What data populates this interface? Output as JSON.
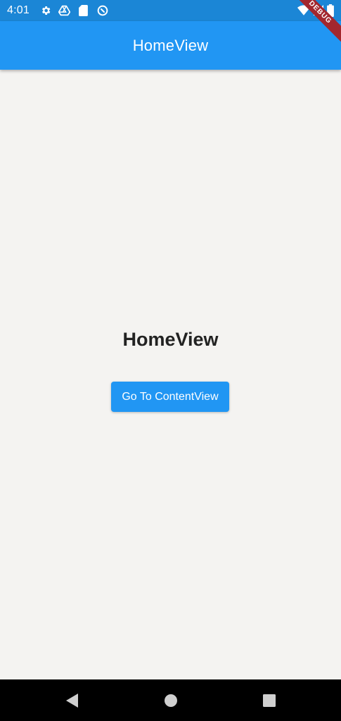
{
  "status_bar": {
    "time": "4:01",
    "icons": [
      "gear-icon",
      "drive-icon",
      "sd-card-icon",
      "vpn-icon",
      "wifi-icon",
      "signal-icon",
      "battery-icon"
    ]
  },
  "app_bar": {
    "title": "HomeView"
  },
  "debug_banner": {
    "label": "DEBUG"
  },
  "main": {
    "heading": "HomeView",
    "button_label": "Go To ContentView"
  },
  "nav_bar": {
    "icons": [
      "back-icon",
      "home-icon",
      "recents-icon"
    ]
  },
  "colors": {
    "status_bar": "#1b86d6",
    "app_bar": "#2196f3",
    "background": "#f4f3f1",
    "button": "#2196f3",
    "debug_banner": "#a3272e",
    "nav_bar": "#000000"
  }
}
